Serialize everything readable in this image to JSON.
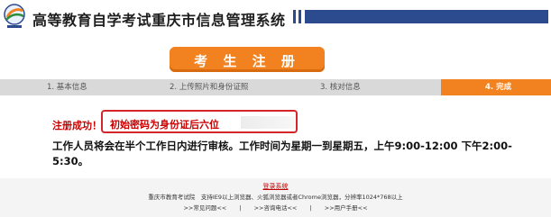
{
  "header": {
    "title": "高等教育自学考试重庆市信息管理系统",
    "logo_icon": "exam-logo-icon",
    "bar_color": "#2c4a8e"
  },
  "banner": {
    "label": "考 生 注 册",
    "color": "#f2811f"
  },
  "steps": [
    {
      "label": "1. 基本信息",
      "active": false
    },
    {
      "label": "2. 上传照片和身份证照",
      "active": false
    },
    {
      "label": "3. 核对信息",
      "active": false
    },
    {
      "label": "4. 完成",
      "active": true
    }
  ],
  "content": {
    "status": "注册成功！",
    "password_note": "初始密码为身份证后六位",
    "notice": "工作人员将会在半个工作日内进行审核。工作时间为星期一到星期五，上午9:00-12:00 下午2:00-5:30。"
  },
  "footer": {
    "login_link": "登录系统",
    "info": "重庆市教育考试院　支持IE9以上浏览器、火狐浏览器或者Chrome浏览器，分辨率1024*768以上",
    "links": [
      ">>常见问题<<",
      "|",
      ">>咨询电话<<",
      "|",
      ">>用户手册<<"
    ]
  }
}
